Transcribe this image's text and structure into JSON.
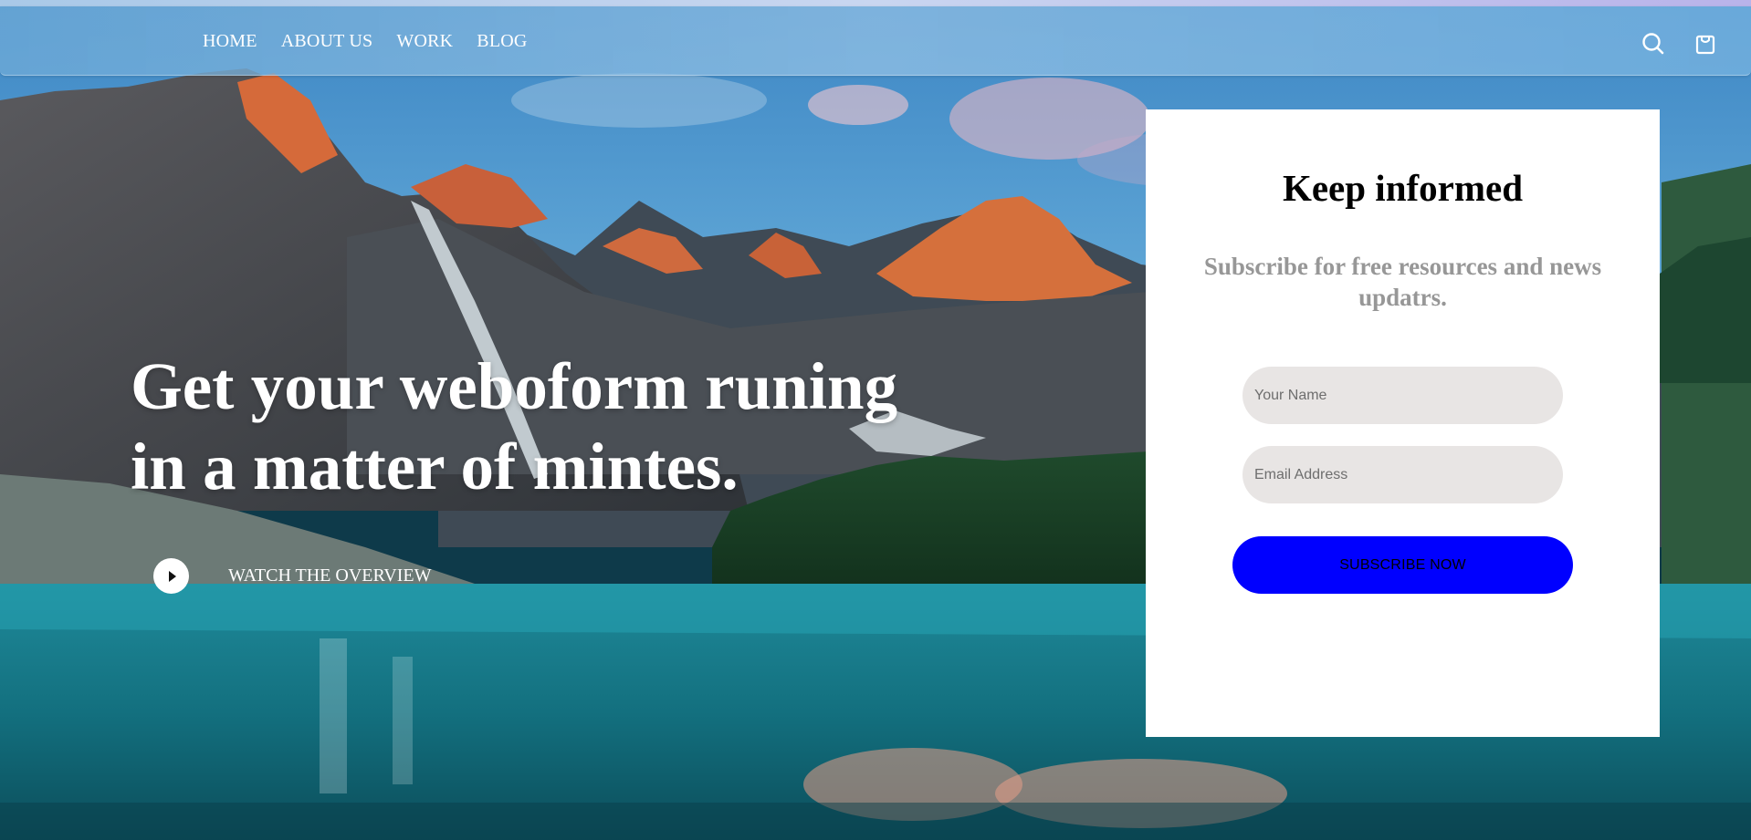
{
  "nav": {
    "items": [
      {
        "label": "HOME"
      },
      {
        "label": "ABOUT US"
      },
      {
        "label": "WORK"
      },
      {
        "label": "BLOG"
      }
    ],
    "icons": [
      "search-icon",
      "cart-icon"
    ]
  },
  "hero": {
    "title_line1": "Get your weboform runing",
    "title_line2": "in a matter of mintes.",
    "watch_label": "WATCH THE OVERVIEW",
    "play_icon": "play-icon"
  },
  "subscribe": {
    "title": "Keep informed",
    "subtitle": "Subscribe for free resources and news updatrs.",
    "name_placeholder": "Your Name",
    "email_placeholder": "Email Address",
    "button_label": "SUBSCRIBE NOW"
  },
  "colors": {
    "button_bg": "#0000ff",
    "field_bg": "#e8e5e4",
    "card_bg": "#ffffff",
    "subtitle_text": "#979797"
  }
}
